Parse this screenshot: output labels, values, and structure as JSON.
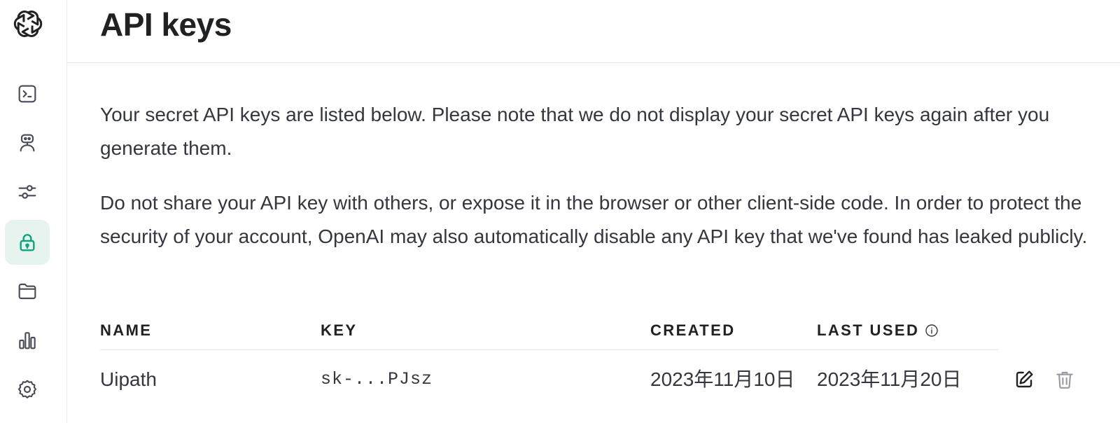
{
  "header": {
    "title": "API keys"
  },
  "sidebar": {
    "items": [
      {
        "icon": "terminal-icon",
        "active": false
      },
      {
        "icon": "assistant-robot-icon",
        "active": false
      },
      {
        "icon": "sliders-icon",
        "active": false
      },
      {
        "icon": "lock-icon",
        "active": true
      },
      {
        "icon": "folder-icon",
        "active": false
      },
      {
        "icon": "bar-chart-icon",
        "active": false
      },
      {
        "icon": "gear-icon",
        "active": false
      }
    ]
  },
  "intro": {
    "paragraph1": "Your secret API keys are listed below. Please note that we do not display your secret API keys again after you generate them.",
    "paragraph2": "Do not share your API key with others, or expose it in the browser or other client-side code. In order to protect the security of your account, OpenAI may also automatically disable any API key that we've found has leaked publicly."
  },
  "table": {
    "columns": {
      "name": "NAME",
      "key": "KEY",
      "created": "CREATED",
      "last_used": "LAST USED"
    },
    "rows": [
      {
        "name": "Uipath",
        "key": "sk-...PJsz",
        "created": "2023年11月10日",
        "last_used": "2023年11月20日"
      }
    ]
  },
  "colors": {
    "accent": "#10a37f",
    "active_bg": "#e6f3ef",
    "icon": "#4a4b57"
  }
}
